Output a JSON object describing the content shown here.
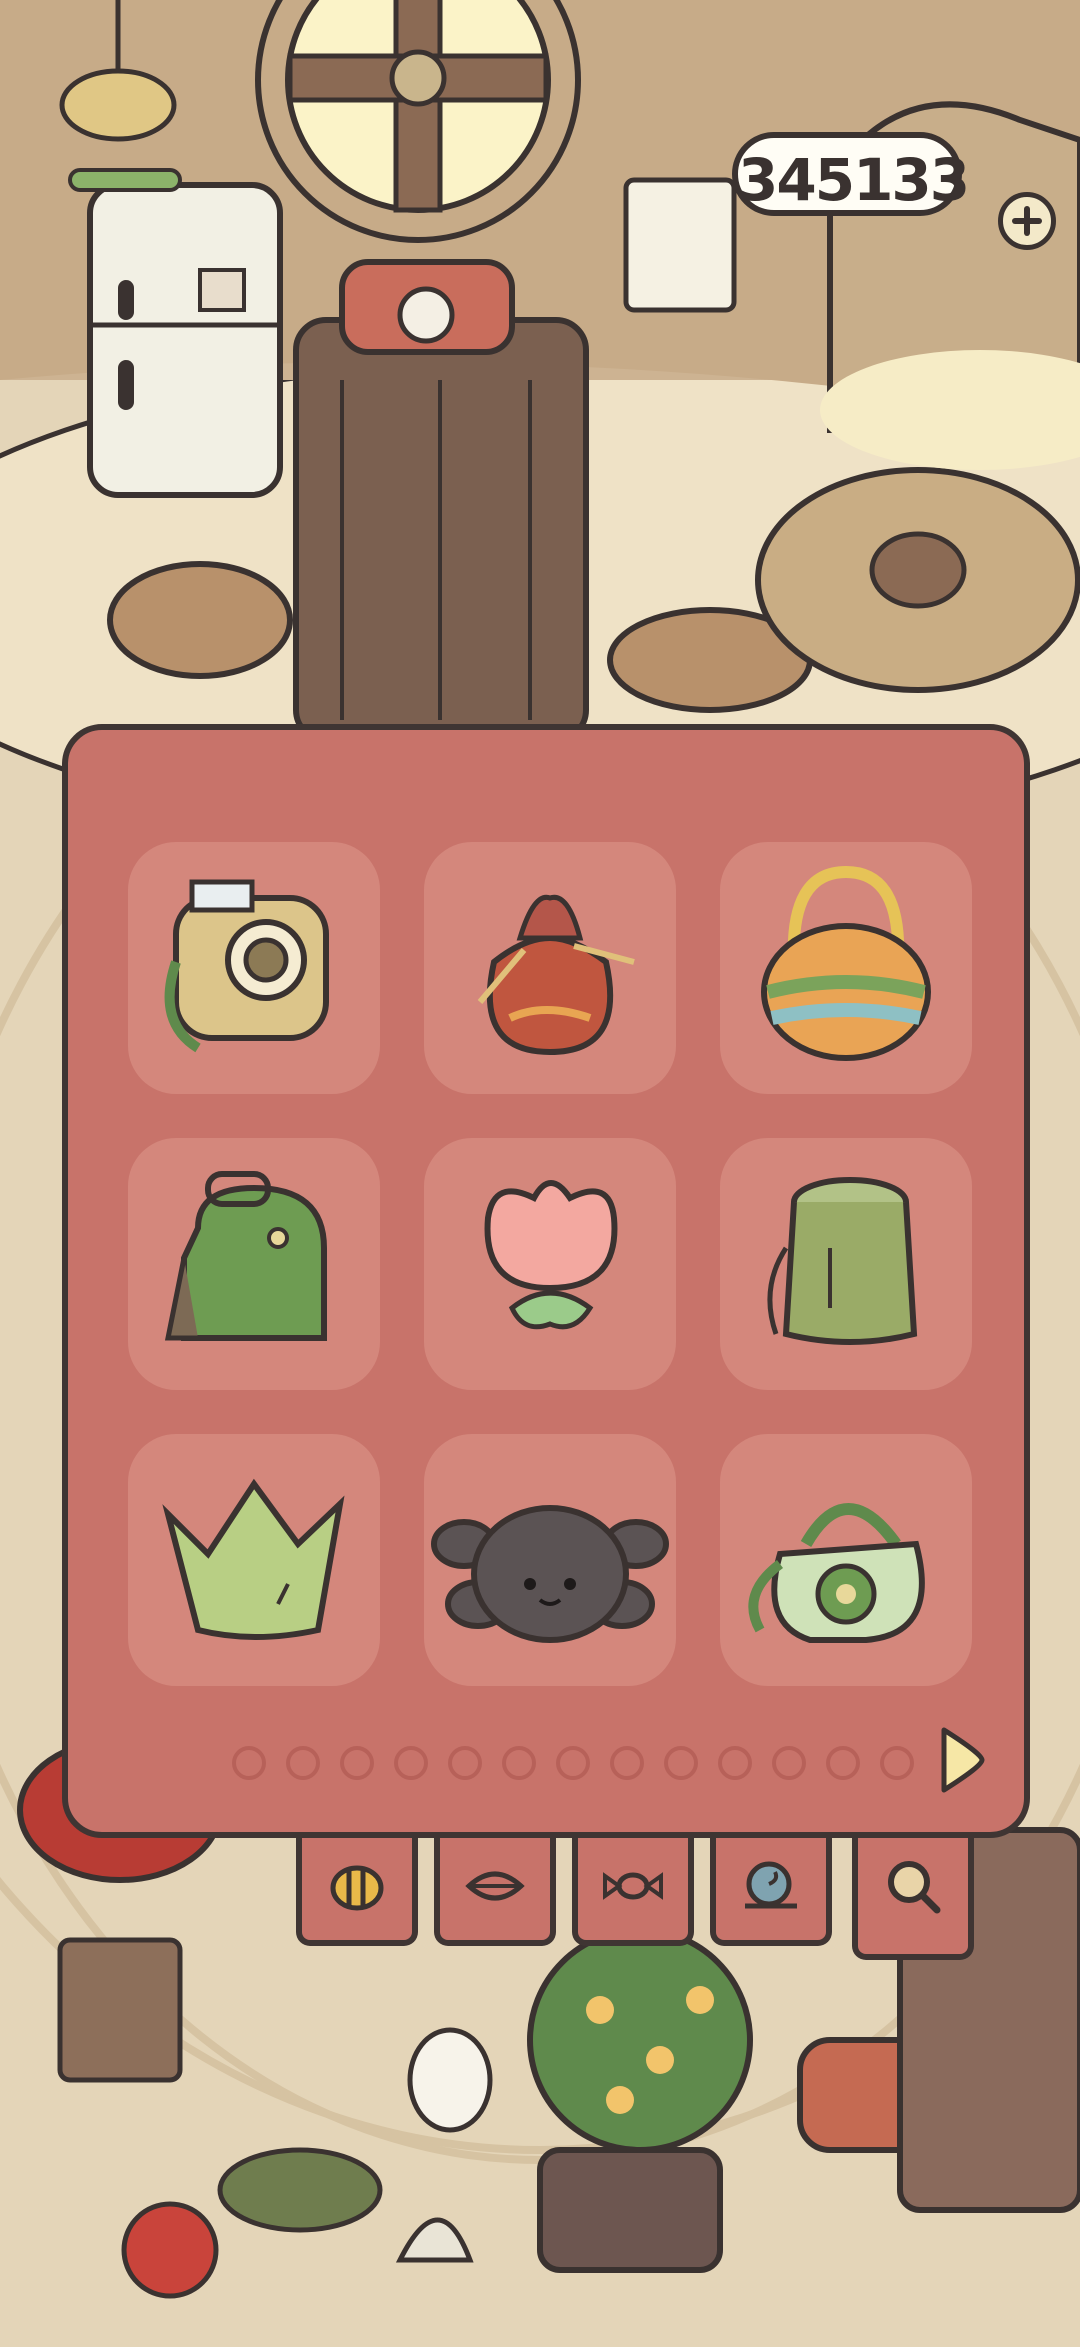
{
  "currency": {
    "amount_text": "345133",
    "add_icon": "plus-icon"
  },
  "bag_grid": {
    "items": [
      {
        "name": "instant-camera",
        "icon": "camera-icon"
      },
      {
        "name": "drawstring-pouch",
        "icon": "pouch-icon"
      },
      {
        "name": "knit-handbag",
        "icon": "knit-bag-icon"
      },
      {
        "name": "green-backpack",
        "icon": "backpack-icon"
      },
      {
        "name": "tulip-bag",
        "icon": "tulip-icon"
      },
      {
        "name": "bamboo-bag",
        "icon": "bamboo-bag-icon"
      },
      {
        "name": "crown-bag",
        "icon": "crown-bag-icon"
      },
      {
        "name": "spider-bag",
        "icon": "spider-icon"
      },
      {
        "name": "flower-tote",
        "icon": "flower-tote-icon"
      }
    ],
    "page_count": 13,
    "next_page_icon": "triangle-right-icon"
  },
  "category_tabs": [
    {
      "name": "bee",
      "icon": "bee-icon"
    },
    {
      "name": "leaf",
      "icon": "leaf-icon"
    },
    {
      "name": "candy",
      "icon": "candy-icon"
    },
    {
      "name": "snail",
      "icon": "snail-icon"
    },
    {
      "name": "search",
      "icon": "magnifier-icon",
      "selected": true
    }
  ],
  "colors": {
    "panel": "#c8736a",
    "slot": "#d4877c",
    "outline": "#3f3533"
  }
}
